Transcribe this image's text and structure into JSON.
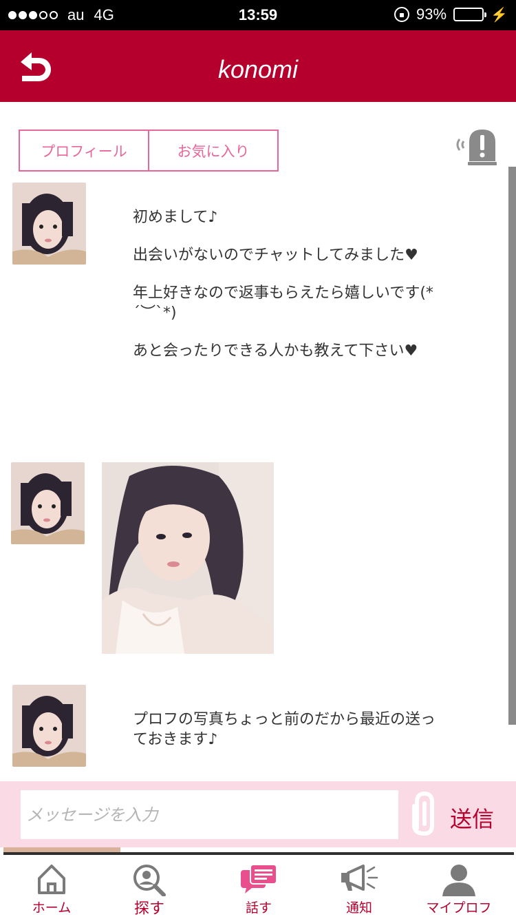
{
  "status_bar": {
    "carrier": "au",
    "network": "4G",
    "time": "13:59",
    "battery": "93%",
    "battery_level": 0.93
  },
  "header": {
    "title": "konomi",
    "back_icon": "back-arrow-icon"
  },
  "tabs": [
    {
      "label": "プロフィール"
    },
    {
      "label": "お気に入り"
    }
  ],
  "messages": [
    {
      "paragraphs": [
        "初めまして♪",
        "出会いがないのでチャットしてみました♥",
        "年上好きなので返事もらえたら嬉しいです(*´︶`*)",
        "あと会ったりできる人かも教えて下さい♥"
      ]
    },
    {
      "image": "selfie-photo"
    },
    {
      "paragraphs": [
        "プロフの写真ちょっと前のだから最近の送っておきます♪"
      ]
    }
  ],
  "composer": {
    "placeholder": "メッセージを入力",
    "send_label": "送信"
  },
  "tabbar": [
    {
      "label": "ホーム",
      "icon": "home-icon"
    },
    {
      "label": "探す",
      "icon": "search-icon"
    },
    {
      "label": "話す",
      "icon": "chat-icon",
      "active": true
    },
    {
      "label": "通知",
      "icon": "megaphone-icon"
    },
    {
      "label": "マイプロフ",
      "icon": "person-icon"
    }
  ],
  "colors": {
    "brand": "#b5002d",
    "accent_pink": "#e8669a",
    "composer_bg": "#fadbe5"
  }
}
